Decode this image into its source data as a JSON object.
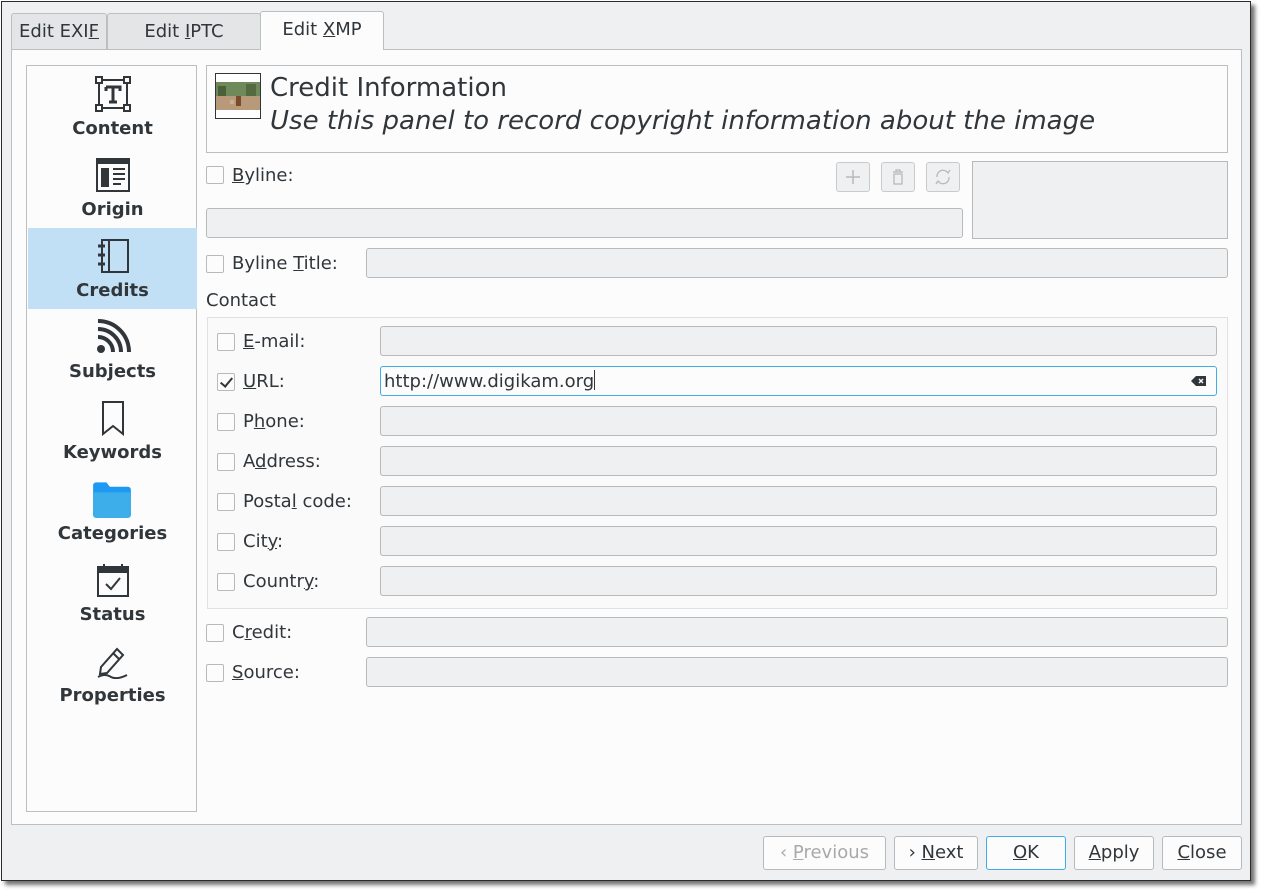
{
  "tabs": [
    {
      "label_pre": "Edit EXI",
      "label_ul": "F",
      "label_post": ""
    },
    {
      "label_pre": "Edit ",
      "label_ul": "I",
      "label_post": "PTC"
    },
    {
      "label_pre": "Edit ",
      "label_ul": "X",
      "label_post": "MP"
    }
  ],
  "sidebar": {
    "items": [
      {
        "label": "Content",
        "icon": "text-frame-icon"
      },
      {
        "label": "Origin",
        "icon": "document-layout-icon"
      },
      {
        "label": "Credits",
        "icon": "notebook-icon",
        "selected": true
      },
      {
        "label": "Subjects",
        "icon": "rss-feed-icon"
      },
      {
        "label": "Keywords",
        "icon": "bookmark-icon"
      },
      {
        "label": "Categories",
        "icon": "folder-icon"
      },
      {
        "label": "Status",
        "icon": "calendar-check-icon"
      },
      {
        "label": "Properties",
        "icon": "pen-edit-icon"
      }
    ]
  },
  "header": {
    "title": "Credit Information",
    "subtitle": "Use this panel to record copyright information about the image"
  },
  "form": {
    "byline": {
      "pre": "",
      "ul": "B",
      "post": "yline:"
    },
    "byline_title": {
      "pre": "Byline ",
      "ul": "T",
      "post": "itle:"
    },
    "contact_label": "Contact",
    "credit": {
      "pre": "C",
      "ul": "r",
      "post": "edit:"
    },
    "source": {
      "pre": "",
      "ul": "S",
      "post": "ource:"
    }
  },
  "contact": [
    {
      "pre": "",
      "ul": "E",
      "post": "-mail:",
      "value": "",
      "checked": false
    },
    {
      "pre": "",
      "ul": "U",
      "post": "RL:",
      "value": "http://www.digikam.org",
      "checked": true
    },
    {
      "pre": "P",
      "ul": "h",
      "post": "one:",
      "value": "",
      "checked": false
    },
    {
      "pre": "A",
      "ul": "d",
      "post": "dress:",
      "value": "",
      "checked": false
    },
    {
      "pre": "Posta",
      "ul": "l",
      "post": " code:",
      "value": "",
      "checked": false
    },
    {
      "pre": "Cit",
      "ul": "y",
      "post": ":",
      "value": "",
      "checked": false
    },
    {
      "pre": "Countr",
      "ul": "y",
      "post": ":",
      "value": "",
      "checked": false
    }
  ],
  "buttons": {
    "previous": {
      "pre": "",
      "ul": "P",
      "post": "revious"
    },
    "next": {
      "pre": "",
      "ul": "N",
      "post": "ext"
    },
    "ok": {
      "pre": "",
      "ul": "O",
      "post": "K"
    },
    "apply": {
      "pre": "",
      "ul": "A",
      "post": "pply"
    },
    "close": {
      "pre": "",
      "ul": "C",
      "post": "lose"
    }
  },
  "colors": {
    "accent": "#3daee9",
    "selection": "#c2e0f5",
    "window": "#eff0f1"
  }
}
